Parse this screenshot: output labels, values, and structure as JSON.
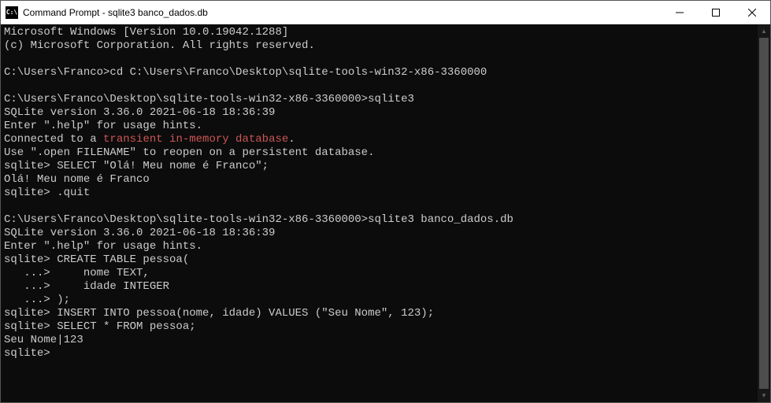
{
  "window": {
    "icon_text": "C:\\",
    "title": "Command Prompt - sqlite3  banco_dados.db"
  },
  "terminal": {
    "lines": [
      {
        "type": "plain",
        "text": "Microsoft Windows [Version 10.0.19042.1288]"
      },
      {
        "type": "plain",
        "text": "(c) Microsoft Corporation. All rights reserved."
      },
      {
        "type": "plain",
        "text": ""
      },
      {
        "type": "plain",
        "text": "C:\\Users\\Franco>cd C:\\Users\\Franco\\Desktop\\sqlite-tools-win32-x86-3360000"
      },
      {
        "type": "plain",
        "text": ""
      },
      {
        "type": "plain",
        "text": "C:\\Users\\Franco\\Desktop\\sqlite-tools-win32-x86-3360000>sqlite3"
      },
      {
        "type": "plain",
        "text": "SQLite version 3.36.0 2021-06-18 18:36:39"
      },
      {
        "type": "plain",
        "text": "Enter \".help\" for usage hints."
      },
      {
        "type": "mixed",
        "prefix": "Connected to a ",
        "red": "transient in-memory database",
        "suffix": "."
      },
      {
        "type": "plain",
        "text": "Use \".open FILENAME\" to reopen on a persistent database."
      },
      {
        "type": "plain",
        "text": "sqlite> SELECT \"Olá! Meu nome é Franco\";"
      },
      {
        "type": "plain",
        "text": "Olá! Meu nome é Franco"
      },
      {
        "type": "plain",
        "text": "sqlite> .quit"
      },
      {
        "type": "plain",
        "text": ""
      },
      {
        "type": "plain",
        "text": "C:\\Users\\Franco\\Desktop\\sqlite-tools-win32-x86-3360000>sqlite3 banco_dados.db"
      },
      {
        "type": "plain",
        "text": "SQLite version 3.36.0 2021-06-18 18:36:39"
      },
      {
        "type": "plain",
        "text": "Enter \".help\" for usage hints."
      },
      {
        "type": "plain",
        "text": "sqlite> CREATE TABLE pessoa("
      },
      {
        "type": "plain",
        "text": "   ...>     nome TEXT,"
      },
      {
        "type": "plain",
        "text": "   ...>     idade INTEGER"
      },
      {
        "type": "plain",
        "text": "   ...> );"
      },
      {
        "type": "plain",
        "text": "sqlite> INSERT INTO pessoa(nome, idade) VALUES (\"Seu Nome\", 123);"
      },
      {
        "type": "plain",
        "text": "sqlite> SELECT * FROM pessoa;"
      },
      {
        "type": "plain",
        "text": "Seu Nome|123"
      },
      {
        "type": "plain",
        "text": "sqlite>"
      }
    ]
  }
}
